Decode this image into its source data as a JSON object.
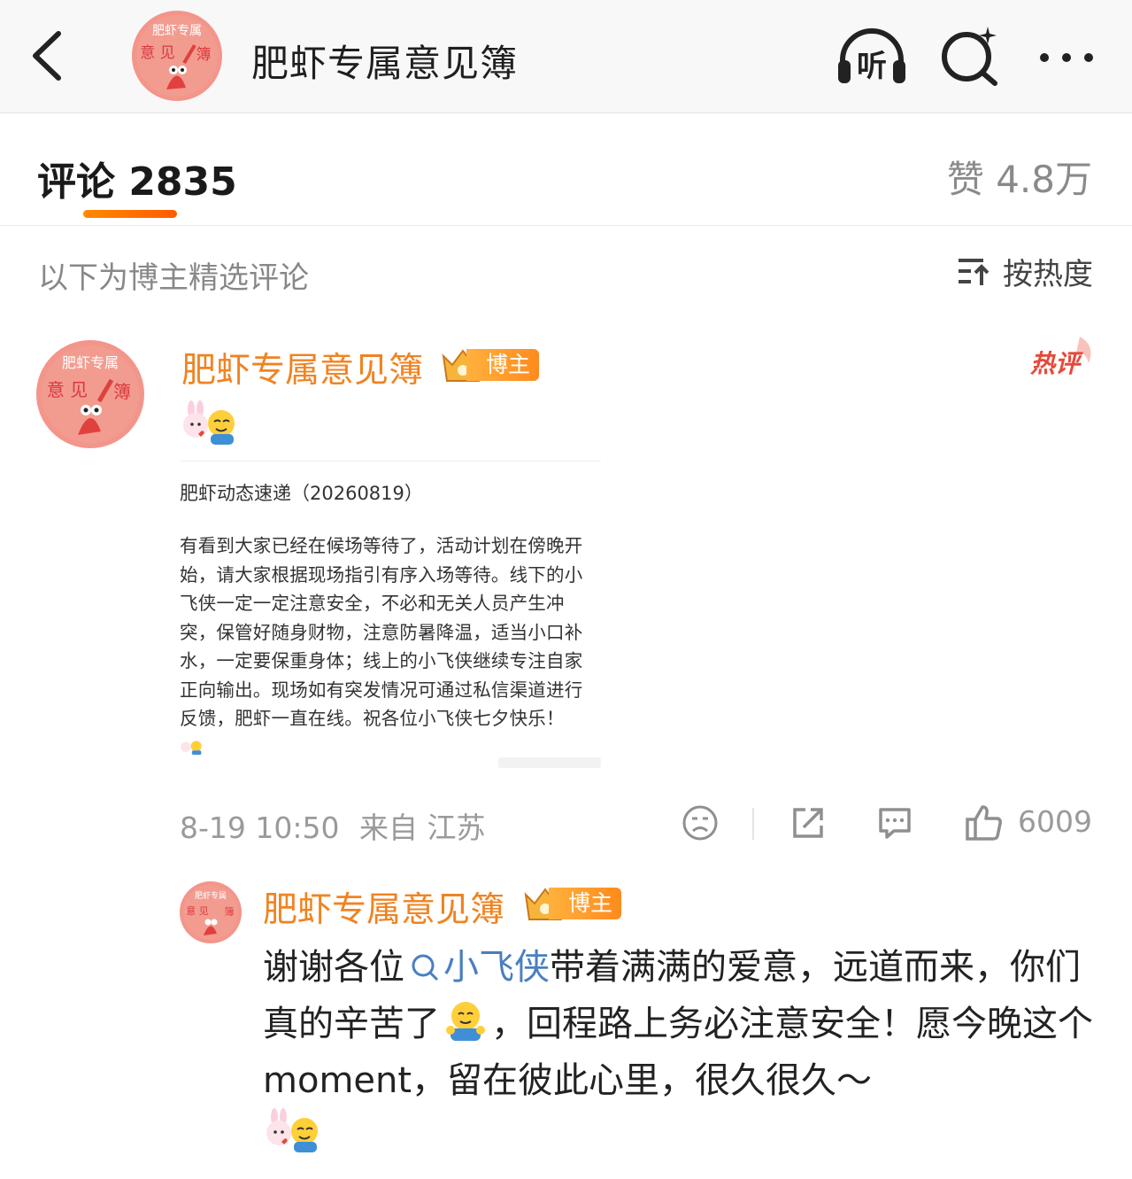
{
  "header": {
    "title": "肥虾专属意见簿",
    "avatar_text": [
      "肥虾专属",
      "意 见",
      "簿"
    ]
  },
  "comments_header": {
    "tab_label": "评论 2835",
    "likes_label": "赞 4.8万"
  },
  "filter": {
    "note": "以下为博主精选评论",
    "sort_label": "按热度"
  },
  "comment": {
    "author": "肥虾专属意见簿",
    "badge": "博主",
    "hot_tag": "热评",
    "post_card": {
      "title": "肥虾动态速递（20260819）",
      "body": "有看到大家已经在候场等待了，活动计划在傍晚开始，请大家根据现场指引有序入场等待。线下的小飞侠一定一定注意安全，不必和无关人员产生冲突，保管好随身财物，注意防暑降温，适当小口补水，一定要保重身体；线上的小飞侠继续专注自家正向输出。现场如有突发情况可通过私信渠道进行反馈，肥虾一直在线。祝各位小飞侠七夕快乐！"
    },
    "time": "8-19 10:50",
    "source": "来自 江苏",
    "like_count": "6009"
  },
  "reply": {
    "author": "肥虾专属意见簿",
    "badge": "博主",
    "text_before_link": "谢谢各位",
    "link_text": "小飞侠",
    "text_after_link": "带着满满的爱意，远道而来，你们真的辛苦了",
    "text_end": "，回程路上务必注意安全！愿今晚这个moment，留在彼此心里，很久很久～"
  },
  "icons": {
    "back": "chevron-left-icon",
    "listen": "headphones-listen-icon",
    "search": "ai-search-icon",
    "more": "more-dots-icon",
    "sort": "sort-icon",
    "dislike": "sad-face-icon",
    "share": "share-icon",
    "comment": "comment-icon",
    "like": "thumbs-up-icon"
  },
  "colors": {
    "accent": "#f08321",
    "link": "#4a7fc0",
    "hot": "#e8483a",
    "avatar_bg": "#f08a7e"
  }
}
